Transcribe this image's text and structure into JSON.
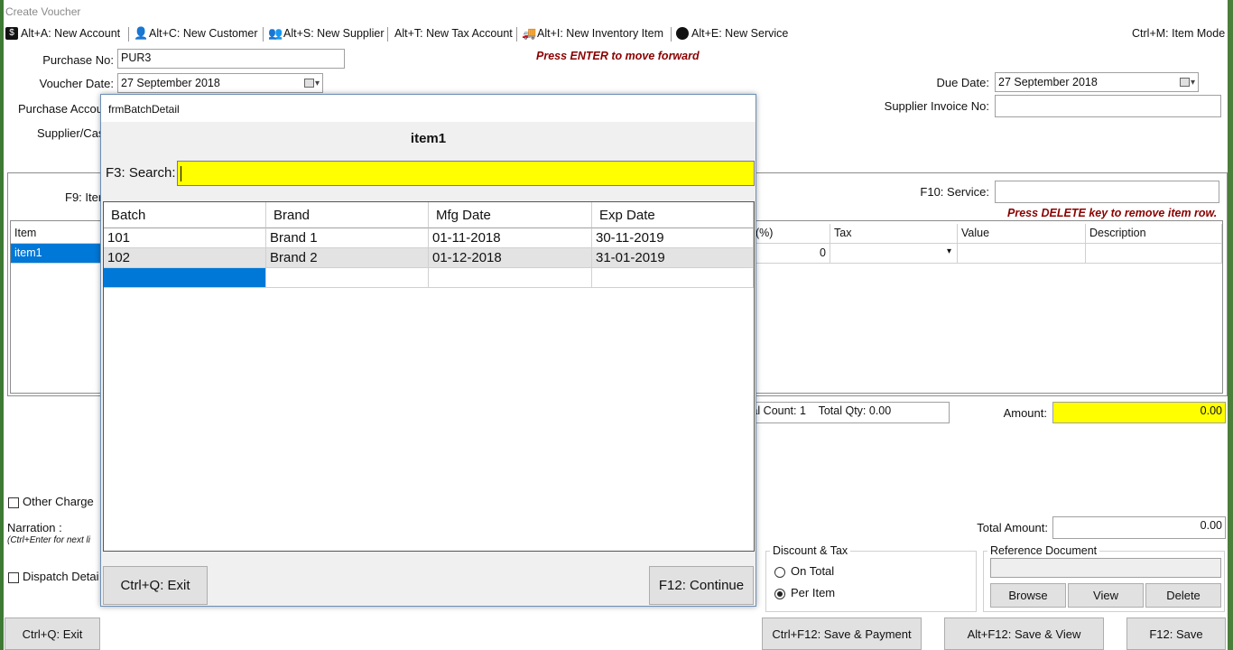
{
  "window": {
    "title": "Create Voucher"
  },
  "shortcuts": [
    {
      "icon": "dollar-icon",
      "glyph": "$",
      "label": "Alt+A: New Account"
    },
    {
      "icon": "customer-icon",
      "glyph": "👤",
      "label": "Alt+C: New Customer"
    },
    {
      "icon": "supplier-icon",
      "glyph": "👥",
      "label": "Alt+S: New Supplier"
    },
    {
      "icon": "",
      "glyph": "",
      "label": "Alt+T: New Tax Account"
    },
    {
      "icon": "truck-icon",
      "glyph": "🚚",
      "label": "Alt+I: New Inventory Item"
    },
    {
      "icon": "service-icon",
      "glyph": "●",
      "label": "Alt+E: New Service"
    }
  ],
  "item_mode": "Ctrl+M: Item Mode",
  "header": {
    "purchase_no_label": "Purchase No:",
    "purchase_no": "PUR3",
    "voucher_date_label": "Voucher Date:",
    "voucher_date": "27 September 2018",
    "purchase_account_label": "Purchase Accou",
    "supplier_label": "Supplier/Cas",
    "enter_hint": "Press ENTER to move forward",
    "due_date_label": "Due Date:",
    "due_date": "27 September 2018",
    "supplier_invoice_label": "Supplier Invoice No:",
    "supplier_invoice": ""
  },
  "grid": {
    "f9_label": "F9: Iter",
    "f10_label": "F10: Service:",
    "f10_value": "",
    "delete_hint": "Press DELETE key to remove item row.",
    "columns": {
      "item": "Item",
      "pct": "(%)",
      "tax": "Tax",
      "value": "Value",
      "description": "Description"
    },
    "row": {
      "item": "item1",
      "pct": "0",
      "tax": "",
      "value": "",
      "description": ""
    }
  },
  "totals": {
    "count_qty": "tal Count: 1    Total Qty: 0.00",
    "amount_label": "Amount:",
    "amount": "0.00",
    "total_amount_label": "Total Amount:",
    "total_amount": "0.00"
  },
  "other_charge_label": "Other Charge",
  "narration_label": "Narration :",
  "narration_hint": "(Ctrl+Enter for next li",
  "dispatch_label": "Dispatch Detai",
  "discount_tax": {
    "title": "Discount & Tax",
    "on_total": "On Total",
    "per_item": "Per Item",
    "selected": "Per Item"
  },
  "reference": {
    "title": "Reference Document",
    "value": "",
    "browse": "Browse",
    "view": "View",
    "delete": "Delete"
  },
  "footer": {
    "exit": "Ctrl+Q: Exit",
    "save_payment": "Ctrl+F12: Save & Payment",
    "save_view": "Alt+F12: Save & View",
    "save": "F12: Save"
  },
  "modal": {
    "title": "frmBatchDetail",
    "heading": "item1",
    "search_label": "F3: Search:",
    "search_value": "",
    "columns": [
      "Batch",
      "Brand",
      "Mfg Date",
      "Exp Date"
    ],
    "rows": [
      [
        "101",
        "Brand 1",
        "01-11-2018",
        "30-11-2019"
      ],
      [
        "102",
        "Brand 2",
        "01-12-2018",
        "31-01-2019"
      ]
    ],
    "exit_button": "Ctrl+Q: Exit",
    "continue_button": "F12: Continue"
  }
}
